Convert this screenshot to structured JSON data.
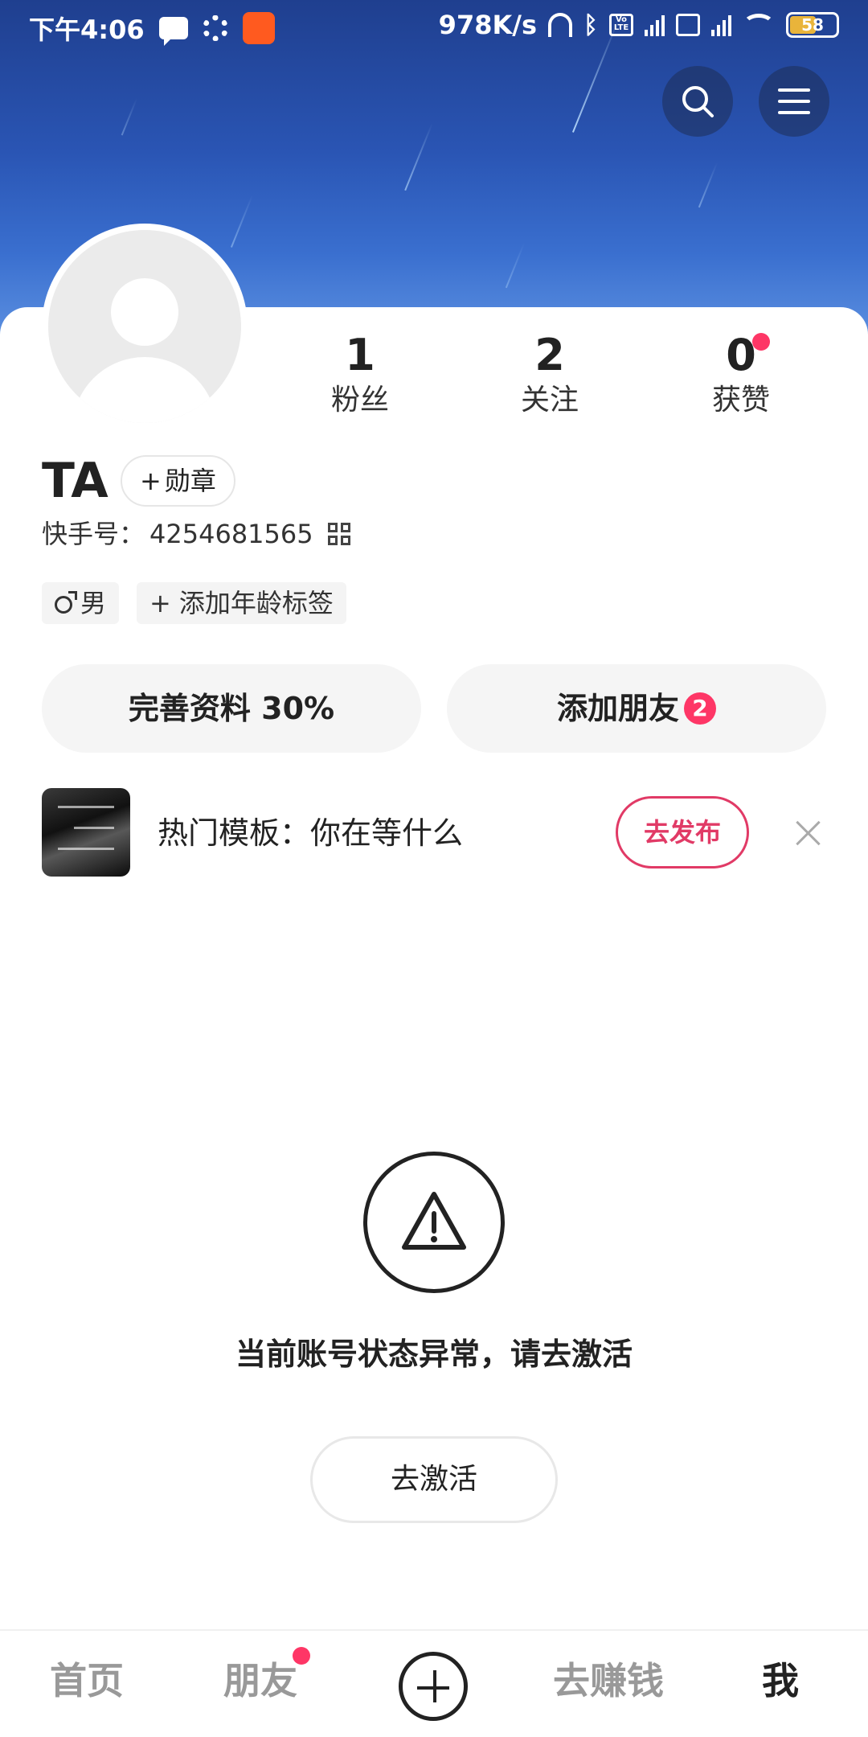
{
  "status_bar": {
    "time": "下午4:06",
    "network_speed": "978K/s",
    "network_type": "4G",
    "volte_label": "Vo LTE",
    "battery": "58"
  },
  "profile": {
    "stats": [
      {
        "value": "1",
        "label": "粉丝"
      },
      {
        "value": "2",
        "label": "关注"
      },
      {
        "value": "0",
        "label": "获赞"
      }
    ],
    "name": "TA",
    "badge_button": "勋章",
    "badge_plus": "+",
    "id_label": "快手号：",
    "id_value": "4254681565",
    "tags": {
      "gender": "男",
      "age_add": "添加年龄标签",
      "age_plus": "+"
    },
    "complete_profile_label": "完善资料 30%",
    "add_friends_label": "添加朋友",
    "add_friends_count": "2"
  },
  "template": {
    "text": "热门模板：你在等什么",
    "publish_label": "去发布"
  },
  "warning": {
    "message": "当前账号状态异常，请去激活",
    "activate_label": "去激活"
  },
  "bottom_nav": {
    "home": "首页",
    "friends": "朋友",
    "earn": "去赚钱",
    "me": "我"
  },
  "colors": {
    "accent_pink": "#fe3666",
    "publish_red": "#e13a66",
    "header_blue": "#2a55b4"
  },
  "icons": [
    "search-icon",
    "menu-icon",
    "qr-code-icon",
    "male-icon",
    "close-icon",
    "warning-icon",
    "plus-icon"
  ]
}
